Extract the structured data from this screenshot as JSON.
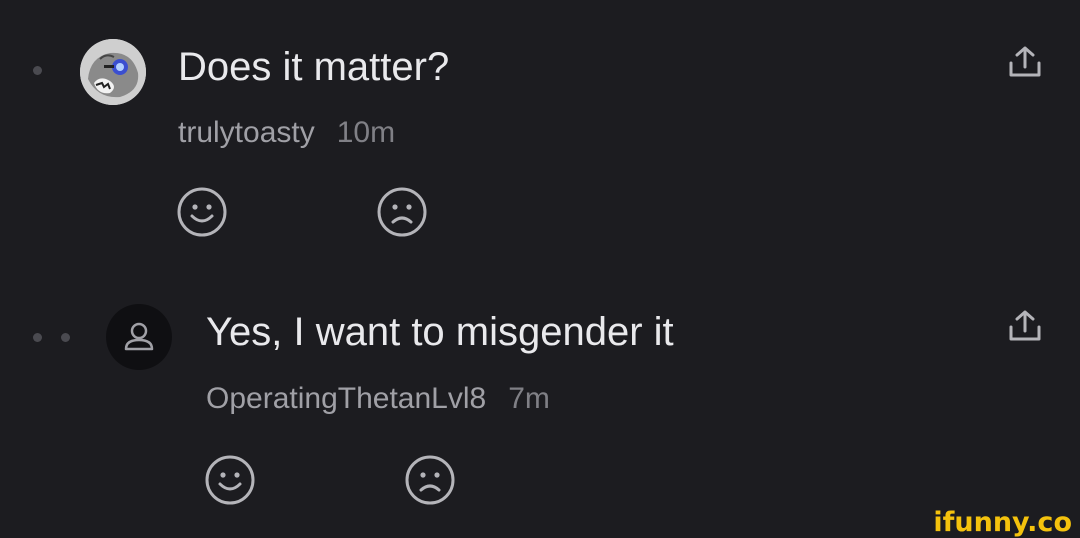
{
  "comments": [
    {
      "text": "Does it matter?",
      "username": "trulytoasty",
      "time": "10m",
      "reactions": {
        "like_icon": "smile-icon",
        "dislike_icon": "frown-icon"
      },
      "share_icon": "share-icon",
      "avatar": "bear-with-sunglasses"
    },
    {
      "text": "Yes, I want to misgender it",
      "username": "OperatingThetanLvl8",
      "time": "7m",
      "reactions": {
        "like_icon": "smile-icon",
        "dislike_icon": "frown-icon"
      },
      "share_icon": "share-icon",
      "avatar": "default-user"
    }
  ],
  "watermark": "ifunny.co",
  "colors": {
    "background": "#1c1c20",
    "text": "#e9e9ec",
    "muted": "#a0a0a6",
    "icon": "#b4b4b9",
    "watermark": "#f4c20d"
  }
}
